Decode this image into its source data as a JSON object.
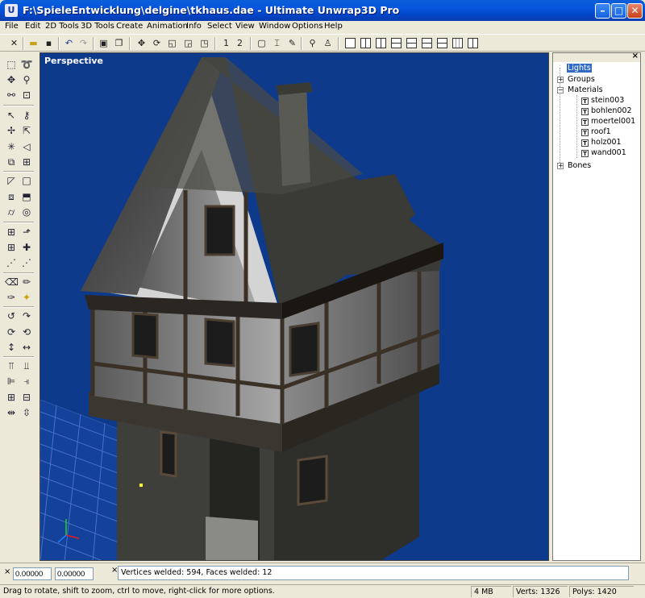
{
  "window": {
    "title": "F:\\SpieleEntwicklung\\delgine\\tkhaus.dae - Ultimate Unwrap3D Pro",
    "app_icon": "U",
    "minimize": "–",
    "maximize": "□",
    "close": "✕"
  },
  "menu": [
    "File",
    "Edit",
    "2D Tools",
    "3D Tools",
    "Create",
    "Animation",
    "Info",
    "Select",
    "View",
    "Options",
    "Window",
    "Help"
  ],
  "toolbar": {
    "layer1": "1",
    "layer2": "2"
  },
  "viewport": {
    "label": "Perspective"
  },
  "scene_tree": {
    "close": "×",
    "lights": "Lights",
    "groups": "Groups",
    "materials": "Materials",
    "material_items": [
      "stein003",
      "bohlen002",
      "moertel001",
      "roof1",
      "holz001",
      "wand001"
    ],
    "bones": "Bones",
    "expand_plus": "+",
    "expand_minus": "−",
    "texture_icon": "T"
  },
  "coords": {
    "x": "0.00000",
    "y": "0.00000"
  },
  "log": {
    "message": "Vertices welded: 594, Faces welded: 12",
    "close": "×"
  },
  "status": {
    "hint": "Drag to rotate, shift to zoom, ctrl to move, right-click for more options.",
    "memory": "4 MB",
    "verts": "Verts: 1326",
    "polys": "Polys: 1420"
  }
}
